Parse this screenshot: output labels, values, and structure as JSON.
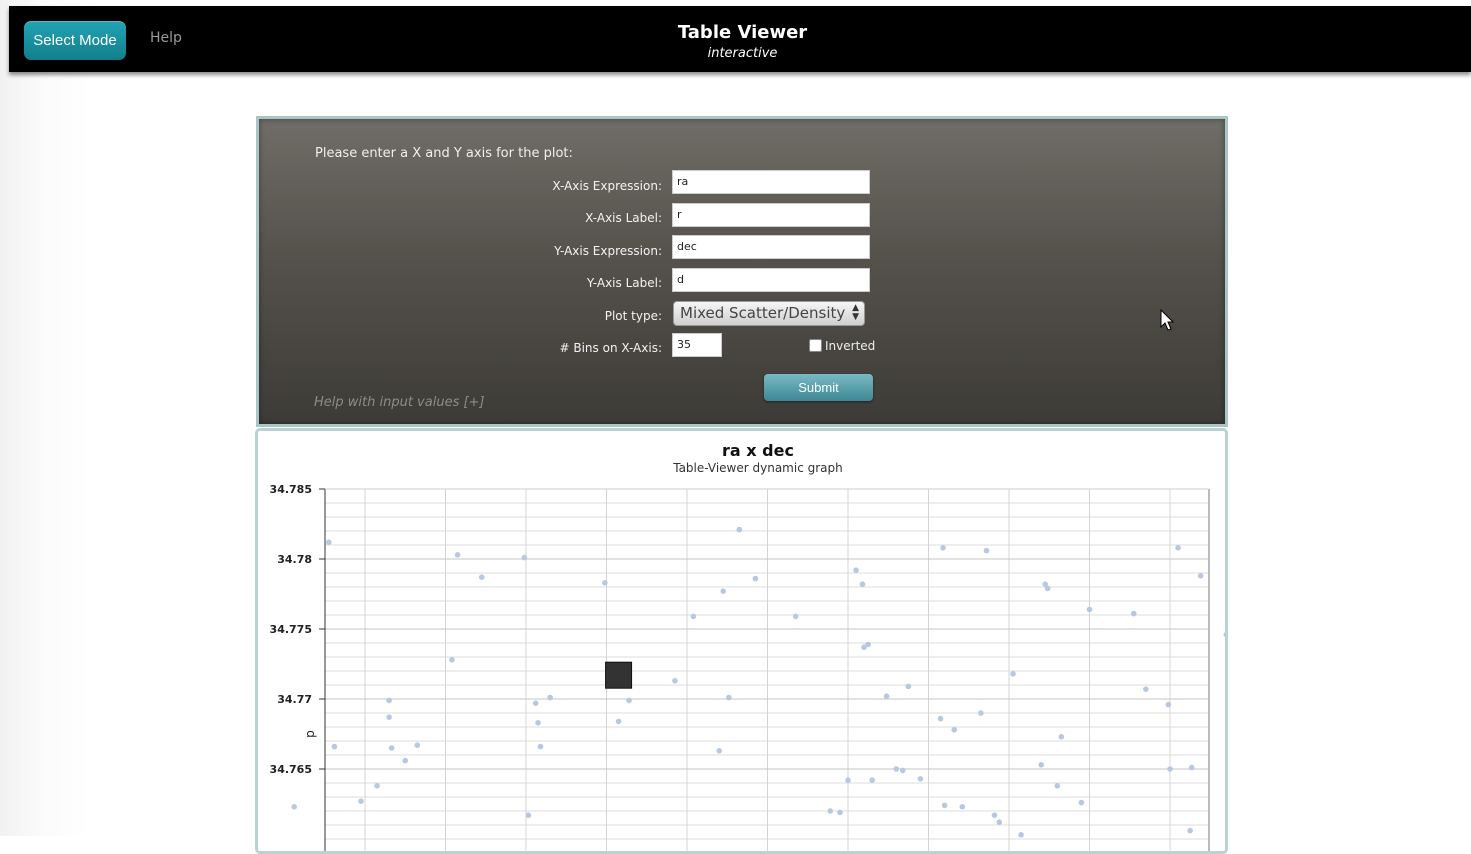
{
  "header": {
    "mode_button": "Select Mode",
    "help_link": "Help",
    "title": "Table Viewer",
    "subtitle": "interactive"
  },
  "form": {
    "prompt": "Please enter a X and Y axis for the plot:",
    "fields": [
      {
        "label": "X-Axis Expression:",
        "value": "ra"
      },
      {
        "label": "X-Axis Label:",
        "value": "r"
      },
      {
        "label": "Y-Axis Expression:",
        "value": "dec"
      },
      {
        "label": "Y-Axis Label:",
        "value": "d"
      }
    ],
    "plot_type_label": "Plot type:",
    "plot_type_value": "Mixed Scatter/Density",
    "bins_label": "# Bins on X-Axis:",
    "bins_value": "35",
    "inverted_label": "Inverted",
    "inverted_checked": false,
    "submit_label": "Submit",
    "help_values": "Help with input values [+]"
  },
  "chart_data": {
    "type": "scatter",
    "title": "ra x dec",
    "subtitle": "Table-Viewer dynamic graph",
    "ylabel": "d",
    "y_ticks": [
      "34.785",
      "34.78",
      "34.775",
      "34.77",
      "34.765"
    ],
    "ylim": [
      34.7625,
      34.785
    ],
    "grid": true,
    "point_color": "#b8c8e0",
    "density_cell_color": "#333333",
    "points": [
      {
        "col": 0.12,
        "y": 34.7623
      },
      {
        "col": 0.55,
        "y": 34.7812
      },
      {
        "col": 0.62,
        "y": 34.7666
      },
      {
        "col": 0.95,
        "y": 34.7627
      },
      {
        "col": 1.15,
        "y": 34.7638
      },
      {
        "col": 1.3,
        "y": 34.7699
      },
      {
        "col": 1.3,
        "y": 34.7687
      },
      {
        "col": 1.33,
        "y": 34.7665
      },
      {
        "col": 1.5,
        "y": 34.7656
      },
      {
        "col": 1.65,
        "y": 34.7667
      },
      {
        "col": 2.08,
        "y": 34.7728
      },
      {
        "col": 2.15,
        "y": 34.7803
      },
      {
        "col": 2.45,
        "y": 34.7787
      },
      {
        "col": 2.98,
        "y": 34.7801
      },
      {
        "col": 3.03,
        "y": 34.7617
      },
      {
        "col": 3.12,
        "y": 34.7697
      },
      {
        "col": 3.15,
        "y": 34.7683
      },
      {
        "col": 3.18,
        "y": 34.7666
      },
      {
        "col": 3.3,
        "y": 34.7701
      },
      {
        "col": 3.98,
        "y": 34.7783
      },
      {
        "col": 4.15,
        "y": 34.7684
      },
      {
        "col": 4.28,
        "y": 34.7699
      },
      {
        "col": 4.85,
        "y": 34.7713
      },
      {
        "col": 5.08,
        "y": 34.7759
      },
      {
        "col": 5.4,
        "y": 34.7663
      },
      {
        "col": 5.45,
        "y": 34.7777
      },
      {
        "col": 5.52,
        "y": 34.7701
      },
      {
        "col": 5.65,
        "y": 34.7821
      },
      {
        "col": 5.85,
        "y": 34.7786
      },
      {
        "col": 6.35,
        "y": 34.7759
      },
      {
        "col": 6.78,
        "y": 34.762
      },
      {
        "col": 6.9,
        "y": 34.7619
      },
      {
        "col": 7.0,
        "y": 34.7642
      },
      {
        "col": 7.1,
        "y": 34.7792
      },
      {
        "col": 7.18,
        "y": 34.7782
      },
      {
        "col": 7.2,
        "y": 34.7737
      },
      {
        "col": 7.25,
        "y": 34.7739
      },
      {
        "col": 7.3,
        "y": 34.7642
      },
      {
        "col": 7.48,
        "y": 34.7702
      },
      {
        "col": 7.6,
        "y": 34.765
      },
      {
        "col": 7.68,
        "y": 34.7649
      },
      {
        "col": 7.75,
        "y": 34.7709
      },
      {
        "col": 7.9,
        "y": 34.7643
      },
      {
        "col": 8.15,
        "y": 34.7686
      },
      {
        "col": 8.18,
        "y": 34.7808
      },
      {
        "col": 8.2,
        "y": 34.7624
      },
      {
        "col": 8.32,
        "y": 34.7678
      },
      {
        "col": 8.42,
        "y": 34.7623
      },
      {
        "col": 8.65,
        "y": 34.769
      },
      {
        "col": 8.72,
        "y": 34.7806
      },
      {
        "col": 8.82,
        "y": 34.7617
      },
      {
        "col": 8.88,
        "y": 34.7612
      },
      {
        "col": 9.05,
        "y": 34.7718
      },
      {
        "col": 9.15,
        "y": 34.7603
      },
      {
        "col": 9.4,
        "y": 34.7653
      },
      {
        "col": 9.45,
        "y": 34.7782
      },
      {
        "col": 9.48,
        "y": 34.7779
      },
      {
        "col": 9.65,
        "y": 34.7673
      },
      {
        "col": 9.6,
        "y": 34.7638
      },
      {
        "col": 9.9,
        "y": 34.7626
      },
      {
        "col": 10.0,
        "y": 34.7764
      },
      {
        "col": 10.55,
        "y": 34.7761
      },
      {
        "col": 10.7,
        "y": 34.7707
      },
      {
        "col": 10.98,
        "y": 34.7696
      },
      {
        "col": 11.0,
        "y": 34.765
      },
      {
        "col": 11.1,
        "y": 34.7808
      },
      {
        "col": 11.27,
        "y": 34.7651
      },
      {
        "col": 11.38,
        "y": 34.7788
      },
      {
        "col": 11.7,
        "y": 34.7746
      },
      {
        "col": 11.25,
        "y": 34.7606
      }
    ],
    "density_cells": [
      {
        "col": 4.15,
        "y": 34.7717
      }
    ]
  }
}
